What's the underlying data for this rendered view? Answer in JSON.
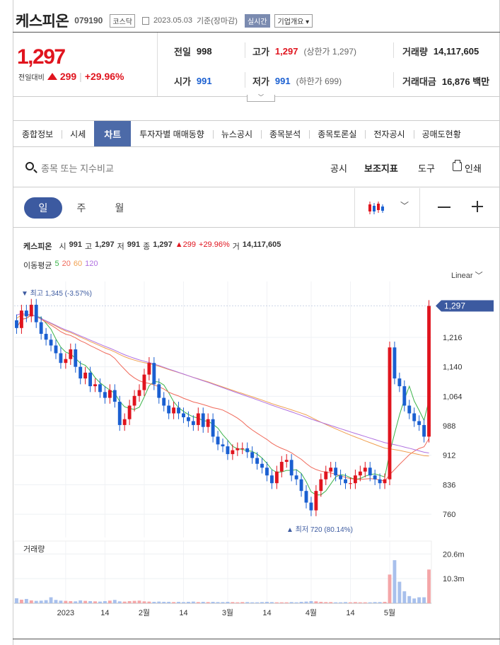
{
  "header": {
    "stock_name": "케스피온",
    "stock_code": "079190",
    "market": "코스닥",
    "date": "2023.05.03",
    "date_suffix": "기준(장마감)",
    "realtime": "실시간",
    "overview": "기업개요"
  },
  "price": {
    "current": "1,297",
    "change_label": "전일대비",
    "change": "299",
    "change_pct": "+29.96%",
    "color_up": "#e0141e",
    "color_down": "#1a5fd1"
  },
  "info": {
    "prev_close_label": "전일",
    "prev_close": "998",
    "high_label": "고가",
    "high": "1,297",
    "high_sub": "(상한가 1,297)",
    "volume_label": "거래량",
    "volume": "14,117,605",
    "open_label": "시가",
    "open": "991",
    "low_label": "저가",
    "low": "991",
    "low_sub": "(하한가 699)",
    "turnover_label": "거래대금",
    "turnover": "16,876 백만"
  },
  "tabs": [
    "종합정보",
    "시세",
    "차트",
    "투자자별 매매동향",
    "뉴스공시",
    "종목분석",
    "종목토론실",
    "전자공시",
    "공매도현황"
  ],
  "active_tab": "차트",
  "search": {
    "placeholder": "종목 또는 지수비교"
  },
  "tools": {
    "disclosure": "공시",
    "indicator": "보조지표",
    "tool": "도구",
    "print": "인쇄"
  },
  "periods": [
    "일",
    "주",
    "월"
  ],
  "icons": [
    "search-icon",
    "print-icon",
    "candlestick-icon",
    "chevron-down-icon",
    "minus-icon",
    "plus-icon"
  ],
  "chart_header": {
    "name": "케스피온",
    "open_label": "시",
    "open": "991",
    "high_label": "고",
    "high": "1,297",
    "low_label": "저",
    "low": "991",
    "close_label": "종",
    "close": "1,297",
    "change": "299",
    "change_pct": "+29.96%",
    "volume_label": "거",
    "volume": "14,117,605"
  },
  "ma": {
    "label": "이동평균",
    "p5": "5",
    "p20": "20",
    "p60": "60",
    "p120": "120",
    "c5": "#3cb44b",
    "c20": "#f0695a",
    "c60": "#f0a050",
    "c120": "#b070e0"
  },
  "scale_mode": "Linear",
  "volume_panel_label": "거래량",
  "chart_data": {
    "type": "candlestick",
    "price_ticks": [
      "1,216",
      "1,140",
      "1,064",
      "988",
      "912",
      "836",
      "760"
    ],
    "price_tick_values": [
      1216,
      1140,
      1064,
      988,
      912,
      836,
      760
    ],
    "last_price_label": "1,297",
    "high_marker": "최고 1,345 (-3.57%)",
    "low_marker": "최저 720 (80.14%)",
    "ylim": [
      700,
      1360
    ],
    "volume_ticks": [
      "20.6m",
      "10.3m"
    ],
    "volume_tick_values": [
      20.6,
      10.3
    ],
    "volume_ylim": [
      0,
      26
    ],
    "x_ticks": [
      "2023",
      "14",
      "2월",
      "14",
      "3월",
      "14",
      "4월",
      "14",
      "5월"
    ],
    "x_tick_index": [
      10,
      18,
      26,
      34,
      43,
      51,
      60,
      68,
      76
    ],
    "closes": [
      1240,
      1285,
      1270,
      1300,
      1255,
      1225,
      1210,
      1195,
      1175,
      1150,
      1160,
      1185,
      1140,
      1110,
      1125,
      1090,
      1095,
      1075,
      1060,
      1080,
      1050,
      990,
      1005,
      1040,
      1065,
      1080,
      1120,
      1150,
      1095,
      1060,
      1040,
      1020,
      1035,
      1020,
      1010,
      1000,
      990,
      1020,
      985,
      1005,
      960,
      940,
      935,
      915,
      925,
      930,
      930,
      920,
      905,
      890,
      880,
      860,
      840,
      870,
      895,
      900,
      860,
      850,
      820,
      790,
      770,
      820,
      850,
      870,
      880,
      860,
      850,
      840,
      840,
      860,
      870,
      880,
      860,
      850,
      840,
      850,
      1190,
      1110,
      1090,
      1040,
      1020,
      1000,
      990,
      960,
      1297
    ],
    "volume_values": [
      2.1,
      1.5,
      1.8,
      1.2,
      1.0,
      1.1,
      1.3,
      2.5,
      1.4,
      1.1,
      1.0,
      0.9,
      0.8,
      1.2,
      1.0,
      0.9,
      0.8,
      0.7,
      0.9,
      1.1,
      1.4,
      0.8,
      0.7,
      0.9,
      1.0,
      1.1,
      0.8,
      0.7,
      0.6,
      0.7,
      0.6,
      0.6,
      0.5,
      0.6,
      0.5,
      0.6,
      0.7,
      0.5,
      0.6,
      0.5,
      0.6,
      0.5,
      0.5,
      0.6,
      0.5,
      0.4,
      0.5,
      0.5,
      0.4,
      0.4,
      0.5,
      0.6,
      0.5,
      0.4,
      0.4,
      0.4,
      0.5,
      0.4,
      0.6,
      0.7,
      0.9,
      0.8,
      0.6,
      0.5,
      0.5,
      0.4,
      0.4,
      0.5,
      0.4,
      0.5,
      0.4,
      0.4,
      0.4,
      0.5,
      0.5,
      0.6,
      12,
      18,
      9,
      5,
      3,
      2,
      2.5,
      2.5,
      14.1
    ]
  }
}
